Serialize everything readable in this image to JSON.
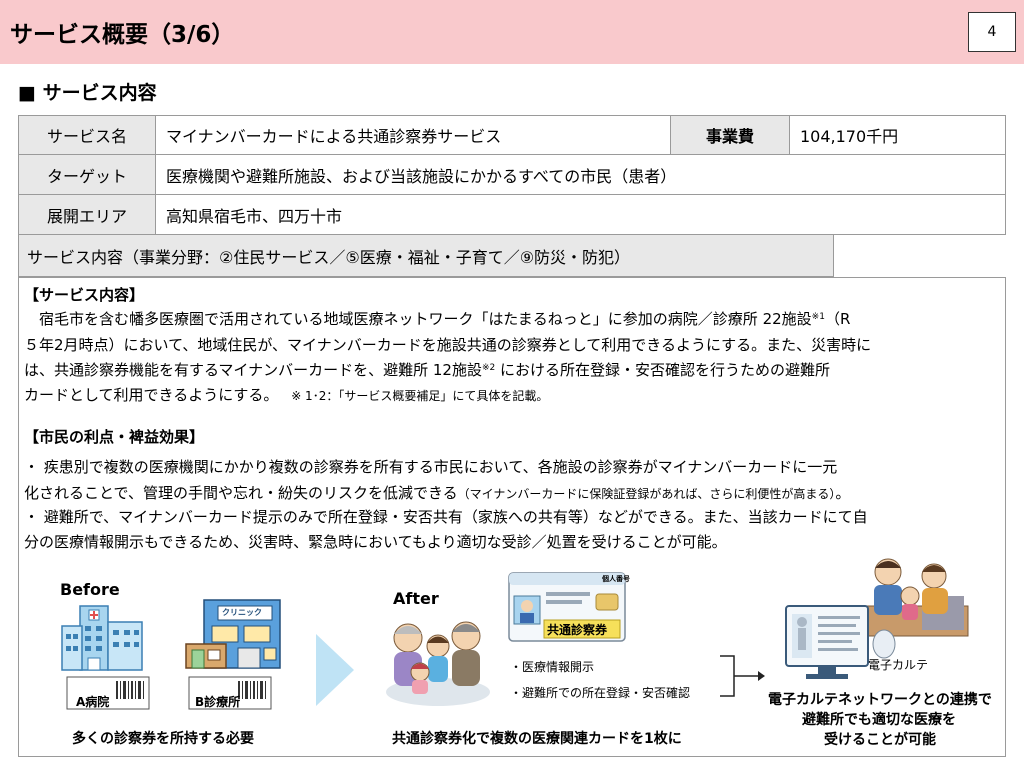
{
  "header": {
    "title": "サービス概要（3/6）",
    "page_number": "4"
  },
  "section": {
    "heading": "■ サービス内容"
  },
  "table": {
    "service_name_label": "サービス名",
    "service_name_value": "マイナンバーカードによる共通診察券サービス",
    "cost_label": "事業費",
    "cost_value": "104,170千円",
    "target_label": "ターゲット",
    "target_value": "医療機関や避難所施設、および当該施設にかかるすべての市民（患者）",
    "area_label": "展開エリア",
    "area_value": "高知県宿毛市、四万十市",
    "content_label": "サービス内容（事業分野：②住民サービス／⑤医療・福祉・子育て／⑨防災・防犯）"
  },
  "content": {
    "service_heading": "【サービス内容】",
    "line1_a": "　宿毛市を含む幡多医療圏で活用されている地域医療ネットワーク「はたまるねっと」に参加の病院／診療所 22施設",
    "line1_sup": "※1",
    "line1_b": "（R",
    "line2": "５年2月時点）において、地域住民が、マイナンバーカードを施設共通の診察券として利用できるようにする。また、災害時に",
    "line3_a": "は、共通診察券機能を有するマイナンバーカードを、避難所 12施設",
    "line3_sup": "※2",
    "line3_b": " における所在登録・安否確認を行うための避難所",
    "line4_a": "カードとして利用できるようにする。",
    "line4_note": "※ 1･2：「サービス概要補足」にて具体を記載。",
    "benefit_heading": "【市民の利点・裨益効果】",
    "benefit1_l1": "・ 疾患別で複数の医療機関にかかり複数の診察券を所有する市民において、各施設の診察券がマイナンバーカードに一元",
    "benefit1_l2_a": "化されることで、管理の手間や忘れ・紛失のリスクを低減できる",
    "benefit1_l2_small": "（マイナンバーカードに保険証登録があれば、さらに利便性が高まる）",
    "benefit1_l2_end": "。",
    "benefit2_l1": "・ 避難所で、マイナンバーカード提示のみで所在登録・安否共有（家族への共有等）などができる。また、当該カードにて自",
    "benefit2_l2": "分の医療情報開示もできるため、災害時、緊急時においてもより適切な受診／処置を受けることが可能。"
  },
  "illustration": {
    "before_label": "Before",
    "hospital_a": "A病院",
    "clinic_b": "B診療所",
    "clinic_sign": "クリニック",
    "before_caption": "多くの診察券を所持する必要",
    "after_label": "After",
    "card_label": "共通診察券",
    "card_header": "個人番号",
    "bullet1": "・医療情報開示",
    "bullet2": "・避難所での所在登録・安否確認",
    "after_caption": "共通診察券化で複数の医療関連カードを1枚に",
    "ekarte_label": "電子カルテ",
    "result_l1": "電子カルテネットワークとの連携で",
    "result_l2": "避難所でも適切な医療を",
    "result_l3": "受けることが可能"
  }
}
